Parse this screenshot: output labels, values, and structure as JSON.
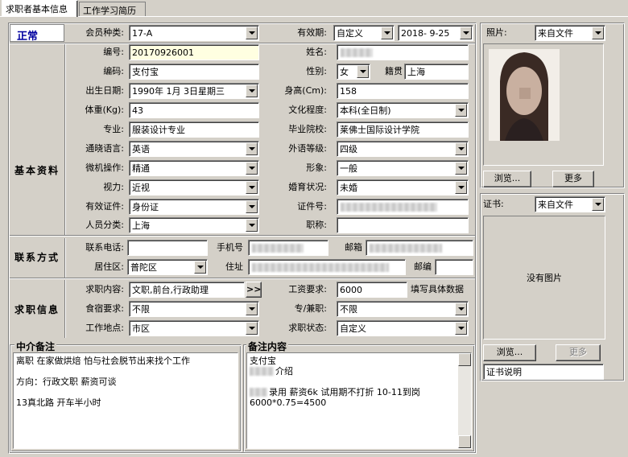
{
  "tabs": [
    "求职者基本信息",
    "工作学习简历"
  ],
  "status": "正常",
  "membership": {
    "label": "会员种类:",
    "value": "17-A"
  },
  "validity": {
    "label": "有效期:",
    "mode": "自定义",
    "date": "2018- 9-25"
  },
  "sections": {
    "basic": "基本资料",
    "contact": "联系方式",
    "job": "求职信息"
  },
  "basic": {
    "number_label": "编号:",
    "number": "20170926001",
    "name_label": "姓名:",
    "name": "",
    "code_label": "编码:",
    "code": "支付宝",
    "gender_label": "性别:",
    "gender": "女",
    "native_label": "籍贯",
    "native": "上海",
    "birth_label": "出生日期:",
    "birth": "1990年 1月 3日星期三",
    "height_label": "身高(Cm):",
    "height": "158",
    "weight_label": "体重(Kg):",
    "weight": "43",
    "edu_label": "文化程度:",
    "edu": "本科(全日制)",
    "major_label": "专业:",
    "major": "服装设计专业",
    "school_label": "毕业院校:",
    "school": "莱佛士国际设计学院",
    "lang_label": "通晓语言:",
    "lang": "英语",
    "lang_level_label": "外语等级:",
    "lang_level": "四级",
    "computer_label": "微机操作:",
    "computer": "精通",
    "image_label": "形象:",
    "image": "一般",
    "vision_label": "视力:",
    "vision": "近视",
    "marital_label": "婚育状况:",
    "marital": "未婚",
    "id_type_label": "有效证件:",
    "id_type": "身份证",
    "id_no_label": "证件号:",
    "id_no": "",
    "category_label": "人员分类:",
    "category": "上海",
    "title_label": "职称:",
    "title": ""
  },
  "contact": {
    "phone_label": "联系电话:",
    "phone": "",
    "mobile_label": "手机号",
    "mobile": "",
    "email_label": "邮箱",
    "email": "",
    "district_label": "居住区:",
    "district": "普陀区",
    "address_label": "住址",
    "address": "",
    "zip_label": "邮编",
    "zip": ""
  },
  "job": {
    "content_label": "求职内容:",
    "content": "文职,前台,行政助理",
    "more_btn": ">>",
    "salary_label": "工资要求:",
    "salary": "6000",
    "salary_hint": "填写具体数据",
    "board_label": "食宿要求:",
    "board": "不限",
    "type_label": "专/兼职:",
    "type": "不限",
    "location_label": "工作地点:",
    "location": "市区",
    "state_label": "求职状态:",
    "state": "自定义"
  },
  "agent_note": {
    "title": "中介备注",
    "lines": [
      "离职 在家做烘焙  怕与社会脱节出来找个工作",
      "",
      "方向：行政文职  薪资可谈",
      "",
      "13真北路          开车半小时"
    ]
  },
  "remark": {
    "title": "备注内容",
    "lines": [
      "支付宝",
      "介绍",
      "",
      "录用  薪资6k 试用期不打折  10-11到岗",
      "6000*0.75=4500"
    ]
  },
  "photo": {
    "label": "照片:",
    "source": "来自文件",
    "browse": "浏览...",
    "more": "更多"
  },
  "cert": {
    "label": "证书:",
    "source": "来自文件",
    "empty": "没有图片",
    "browse": "浏览...",
    "more": "更多",
    "desc": "证书说明"
  }
}
